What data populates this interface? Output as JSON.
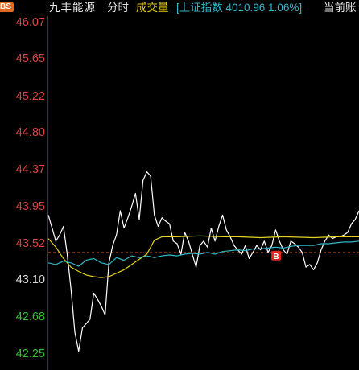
{
  "header": {
    "badge": "BS",
    "stock_name": "九丰能源",
    "tab_time": "分时",
    "tab_volume": "成交量",
    "index_info": "[上证指数 4010.96 1.06%]",
    "truncated_label": "当前账"
  },
  "price_axis": {
    "labels": [
      {
        "text": "46.07",
        "value": 46.07,
        "color": "#e04040"
      },
      {
        "text": "45.65",
        "value": 45.65,
        "color": "#e04040"
      },
      {
        "text": "45.22",
        "value": 45.22,
        "color": "#e04040"
      },
      {
        "text": "44.80",
        "value": 44.8,
        "color": "#e04040"
      },
      {
        "text": "44.37",
        "value": 44.37,
        "color": "#e04040"
      },
      {
        "text": "43.95",
        "value": 43.95,
        "color": "#e04040"
      },
      {
        "text": "43.52",
        "value": 43.52,
        "color": "#e04040"
      },
      {
        "text": "43.10",
        "value": 43.1,
        "color": "#d8d8d8"
      },
      {
        "text": "42.68",
        "value": 42.68,
        "color": "#2ec82e"
      },
      {
        "text": "42.25",
        "value": 42.25,
        "color": "#2ec82e"
      }
    ]
  },
  "chart_data": {
    "type": "line",
    "ylim": [
      42.25,
      46.07
    ],
    "reference_price": 43.52,
    "series": [
      {
        "name": "",
        "color": "#ffffff",
        "points": [
          [
            0,
            43.85
          ],
          [
            1,
            43.7
          ],
          [
            2,
            43.55
          ],
          [
            3,
            43.62
          ],
          [
            4,
            43.72
          ],
          [
            5,
            43.4
          ],
          [
            6,
            43.0
          ],
          [
            7,
            42.5
          ],
          [
            8,
            42.28
          ],
          [
            9,
            42.55
          ],
          [
            10,
            42.6
          ],
          [
            11,
            42.65
          ],
          [
            12,
            42.95
          ],
          [
            13,
            42.88
          ],
          [
            14,
            42.8
          ],
          [
            15,
            42.7
          ],
          [
            16,
            43.3
          ],
          [
            17,
            43.5
          ],
          [
            18,
            43.62
          ],
          [
            19,
            43.9
          ],
          [
            20,
            43.7
          ],
          [
            21,
            43.82
          ],
          [
            22,
            43.95
          ],
          [
            23,
            44.1
          ],
          [
            24,
            43.8
          ],
          [
            25,
            44.25
          ],
          [
            26,
            44.35
          ],
          [
            27,
            44.3
          ],
          [
            28,
            43.85
          ],
          [
            29,
            43.72
          ],
          [
            30,
            43.82
          ],
          [
            31,
            43.78
          ],
          [
            32,
            43.75
          ],
          [
            33,
            43.55
          ],
          [
            34,
            43.52
          ],
          [
            35,
            43.4
          ],
          [
            36,
            43.65
          ],
          [
            37,
            43.55
          ],
          [
            38,
            43.4
          ],
          [
            39,
            43.25
          ],
          [
            40,
            43.5
          ],
          [
            41,
            43.55
          ],
          [
            42,
            43.48
          ],
          [
            43,
            43.7
          ],
          [
            44,
            43.55
          ],
          [
            45,
            43.72
          ],
          [
            46,
            43.85
          ],
          [
            47,
            43.68
          ],
          [
            48,
            43.6
          ],
          [
            49,
            43.5
          ],
          [
            50,
            43.45
          ],
          [
            51,
            43.4
          ],
          [
            52,
            43.5
          ],
          [
            53,
            43.35
          ],
          [
            54,
            43.42
          ],
          [
            55,
            43.5
          ],
          [
            56,
            43.45
          ],
          [
            57,
            43.55
          ],
          [
            58,
            43.42
          ],
          [
            59,
            43.5
          ],
          [
            60,
            43.68
          ],
          [
            61,
            43.55
          ],
          [
            62,
            43.45
          ],
          [
            63,
            43.4
          ],
          [
            64,
            43.55
          ],
          [
            65,
            43.52
          ],
          [
            66,
            43.48
          ],
          [
            67,
            43.42
          ],
          [
            68,
            43.25
          ],
          [
            69,
            43.28
          ],
          [
            70,
            43.22
          ],
          [
            71,
            43.3
          ],
          [
            72,
            43.45
          ],
          [
            73,
            43.55
          ],
          [
            74,
            43.62
          ],
          [
            75,
            43.58
          ],
          [
            76,
            43.6
          ],
          [
            77,
            43.6
          ],
          [
            78,
            43.62
          ],
          [
            79,
            43.65
          ],
          [
            80,
            43.75
          ],
          [
            81,
            43.8
          ],
          [
            82,
            43.9
          ]
        ]
      },
      {
        "name": "",
        "color": "#e3d21e",
        "points": [
          [
            0,
            43.58
          ],
          [
            2,
            43.48
          ],
          [
            4,
            43.35
          ],
          [
            6,
            43.25
          ],
          [
            8,
            43.2
          ],
          [
            10,
            43.16
          ],
          [
            12,
            43.14
          ],
          [
            14,
            43.13
          ],
          [
            16,
            43.14
          ],
          [
            18,
            43.18
          ],
          [
            20,
            43.22
          ],
          [
            22,
            43.28
          ],
          [
            24,
            43.34
          ],
          [
            26,
            43.4
          ],
          [
            28,
            43.56
          ],
          [
            30,
            43.6
          ],
          [
            34,
            43.6
          ],
          [
            40,
            43.61
          ],
          [
            46,
            43.6
          ],
          [
            50,
            43.6
          ],
          [
            56,
            43.59
          ],
          [
            62,
            43.6
          ],
          [
            70,
            43.59
          ],
          [
            76,
            43.6
          ],
          [
            82,
            43.6
          ]
        ]
      },
      {
        "name": "",
        "color": "#2cb8c8",
        "points": [
          [
            0,
            43.3
          ],
          [
            2,
            43.28
          ],
          [
            4,
            43.32
          ],
          [
            6,
            43.3
          ],
          [
            8,
            43.26
          ],
          [
            10,
            43.33
          ],
          [
            12,
            43.35
          ],
          [
            14,
            43.3
          ],
          [
            16,
            43.28
          ],
          [
            18,
            43.36
          ],
          [
            20,
            43.33
          ],
          [
            22,
            43.38
          ],
          [
            24,
            43.36
          ],
          [
            26,
            43.38
          ],
          [
            28,
            43.36
          ],
          [
            30,
            43.38
          ],
          [
            32,
            43.39
          ],
          [
            34,
            43.38
          ],
          [
            36,
            43.4
          ],
          [
            38,
            43.41
          ],
          [
            40,
            43.4
          ],
          [
            42,
            43.42
          ],
          [
            44,
            43.4
          ],
          [
            46,
            43.43
          ],
          [
            48,
            43.44
          ],
          [
            50,
            43.45
          ],
          [
            52,
            43.44
          ],
          [
            54,
            43.46
          ],
          [
            56,
            43.46
          ],
          [
            58,
            43.47
          ],
          [
            60,
            43.48
          ],
          [
            62,
            43.47
          ],
          [
            64,
            43.49
          ],
          [
            66,
            43.5
          ],
          [
            68,
            43.5
          ],
          [
            70,
            43.5
          ],
          [
            72,
            43.52
          ],
          [
            74,
            43.52
          ],
          [
            76,
            43.53
          ],
          [
            78,
            43.54
          ],
          [
            80,
            43.54
          ],
          [
            82,
            43.55
          ]
        ]
      }
    ],
    "marker": {
      "label": "B",
      "x": 58,
      "value": 43.42,
      "color": "#e0261e"
    },
    "grid": false
  }
}
